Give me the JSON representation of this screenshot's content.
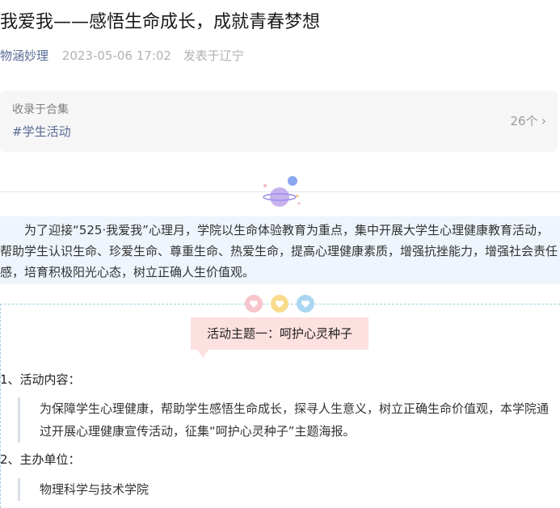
{
  "article": {
    "title": "我爱我——感悟生命成长，成就青春梦想",
    "author": "物涵妙理",
    "time": "2023-05-06 17:02",
    "location": "发表于辽宁"
  },
  "collection": {
    "label": "收录于合集",
    "tag": "#学生活动",
    "count": "26个"
  },
  "intro": {
    "text": "为了迎接“525·我爱我”心理月，学院以生命体验教育为重点，集中开展大学生心理健康教育活动，帮助学生认识生命、珍爱生命、尊重生命、热爱生命，提高心理健康素质，增强抗挫能力，增强社会责任感，培育积极阳光心态，树立正确人生价值观。"
  },
  "theme": {
    "title": "活动主题一：呵护心灵种子"
  },
  "sections": [
    {
      "heading": "1、活动内容：",
      "body": "为保障学生心理健康，帮助学生感悟生命成长，探寻人生意义，树立正确生命价值观，本学院通过开展心理健康宣传活动，征集“呵护心灵种子”主题海报。"
    },
    {
      "heading": "2、主办单位：",
      "body": "物理科学与技术学院"
    }
  ],
  "colors": {
    "link": "#576b95",
    "intro_bg": "#eef5fc",
    "theme_bg": "#fde0e0",
    "dashed": "#9fd3e0"
  },
  "icons": {
    "chevron": "chevron-right-icon",
    "planet": "planet-icon",
    "hearts": [
      "heart-icon-pink",
      "heart-icon-yellow",
      "heart-icon-blue"
    ]
  }
}
